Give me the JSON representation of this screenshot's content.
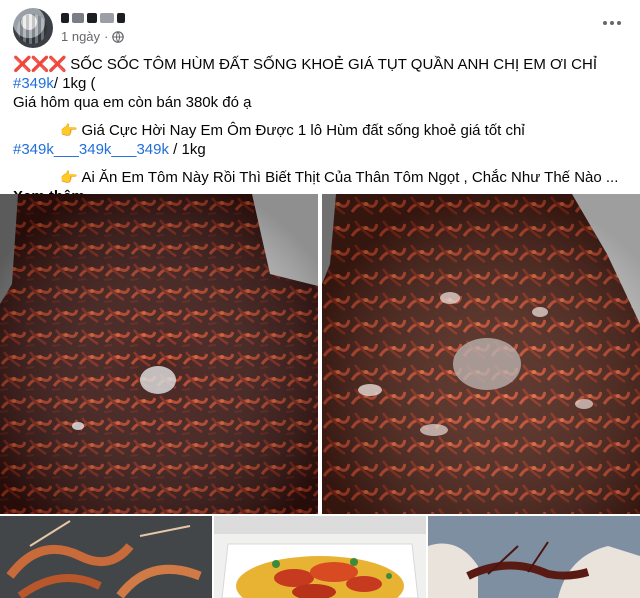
{
  "post": {
    "author_name": "",
    "timestamp": "1 ngày",
    "privacy": "globe-icon",
    "caption": {
      "line1_marks": "❌❌❌",
      "line1_text": " SỐC SỐC TÔM HÙM ĐẤT SỐNG KHOẺ GIÁ TỤT QUẦN ANH CHỊ EM ƠI CHỈ ",
      "line1_tag": "#349k",
      "line1_tail": "/ 1kg (",
      "line2": "Giá hôm qua em còn bán 380k đó ạ",
      "line3_text": "Giá Cực Hời Nay Em Ôm Được 1 lô Hùm đất sống khoẻ giá tốt chỉ",
      "line4_tag": "#349k___349k___349k",
      "line4_tail": " / 1kg",
      "line5_text": "Ai Ăn Em Tôm Này Rồi Thì Biết Thịt Của Thân Tôm Ngọt , Chắc Như Thế Nào ... ",
      "see_more": "Xem thêm"
    },
    "images": [
      {
        "id": "photo-1",
        "subject": "crayfish-tank"
      },
      {
        "id": "photo-2",
        "subject": "crayfish-tank"
      },
      {
        "id": "photo-3",
        "subject": "crayfish-closeup"
      },
      {
        "id": "photo-4",
        "subject": "crayfish-platter"
      },
      {
        "id": "photo-5",
        "subject": "crayfish-held"
      }
    ]
  },
  "colors": {
    "link": "#216fdb",
    "secondary_text": "#65676b",
    "mark_red": "#e0242f",
    "crayfish": "#8b1e12"
  }
}
